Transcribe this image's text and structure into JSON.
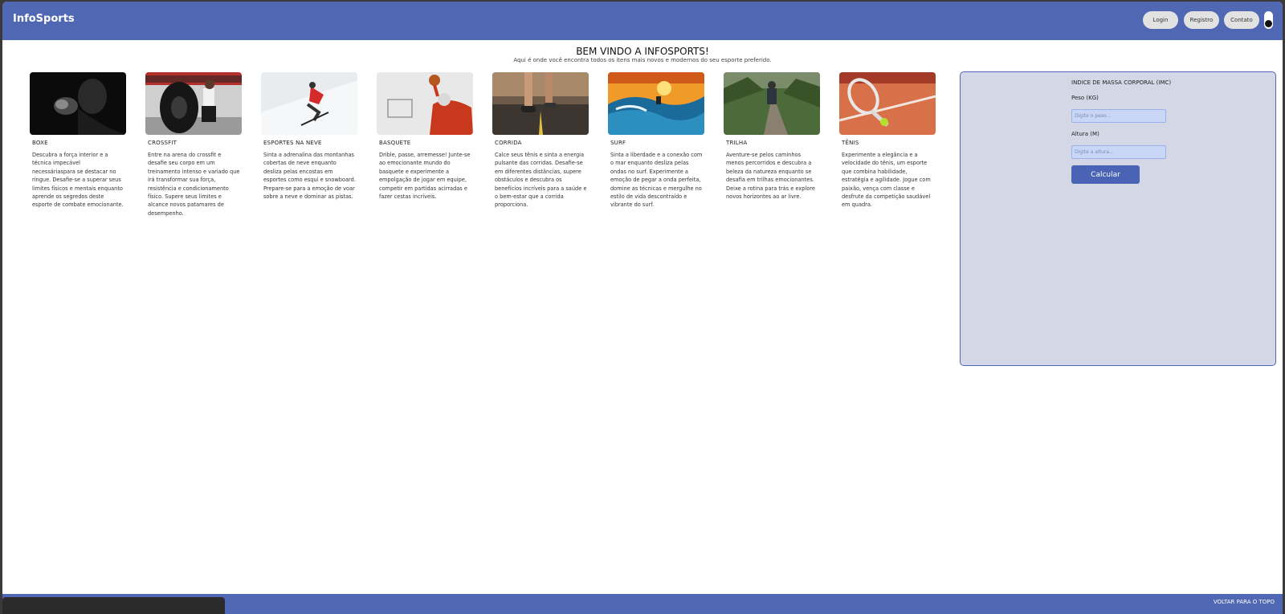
{
  "nav": {
    "brand": "InfoSports",
    "login_label": "Login",
    "register_label": "Registro",
    "contact_label": "Contato"
  },
  "welcome": {
    "title": "BEM VINDO A INFOSPORTS!",
    "subtitle": "Aqui é onde você encontra todos os itens mais novos e modernos do seu esporte preferido."
  },
  "sports": [
    {
      "name": "BOXE",
      "desc": "Descubra a força interior e a técnica impecável necessáriaspara se destacar no ringue. Desafie-se a superar seus limites físicos e mentais enquanto aprende os segredos deste esporte de combate emocionante."
    },
    {
      "name": "CROSSFIT",
      "desc": "Entre na arena do crossfit e desafie seu corpo em um treinamento intenso e variado que irá transformar sua força, resistência e condicionamento físico. Supere seus limites e alcance novos patamares de desempenho."
    },
    {
      "name": "ESPORTES NA NEVE",
      "desc": "Sinta a adrenalina das montanhas cobertas de neve enquanto desliza pelas encostas em esportes como esqui e snowboard. Prepare-se para a emoção de voar sobre a neve e dominar as pistas."
    },
    {
      "name": "BASQUETE",
      "desc": "Drible, passe, arremesse! Junte-se ao emocionante mundo do basquete e experimente a empolgação de jogar em equipe, competir em partidas acirradas e fazer cestas incríveis."
    },
    {
      "name": "CORRIDA",
      "desc": "Calce seus tênis e sinta a energia pulsante das corridas. Desafie-se em diferentes distâncias, supere obstáculos e descubra os benefícios incríveis para a saúde e o bem-estar que a corrida proporciona."
    },
    {
      "name": "SURF",
      "desc": "Sinta a liberdade e a conexão com o mar enquanto desliza pelas ondas no surf. Experimente a emoção de pegar a onda perfeita, domine as técnicas e mergulhe no estilo de vida descontraído e vibrante do surf."
    },
    {
      "name": "TRILHA",
      "desc": "Aventure-se pelos caminhos menos percorridos e descubra a beleza da natureza enquanto se desafia em trilhas emocionantes. Deixe a rotina para trás e explore novos horizontes ao ar livre."
    },
    {
      "name": "TÊNIS",
      "desc": "Experimente a elegância e a velocidade do tênis, um esporte que combina habilidade, estratégia e agilidade. Jogue com paixão, vença com classe e desfrute da competição saudável em quadra."
    }
  ],
  "imc": {
    "title": "INDICE DE MASSA CORPORAL (IMC)",
    "weight_label": "Peso (KG)",
    "weight_placeholder": "Digite o peso...",
    "height_label": "Altura (M)",
    "height_placeholder": "Digite a altura...",
    "button_label": "Calcular"
  },
  "footer": {
    "back_to_top": "VOLTAR PARA O TOPO"
  },
  "colors": {
    "primary": "#5068b4",
    "panel_bg": "#d3d7e6",
    "input_bg": "#c9d6f5"
  }
}
